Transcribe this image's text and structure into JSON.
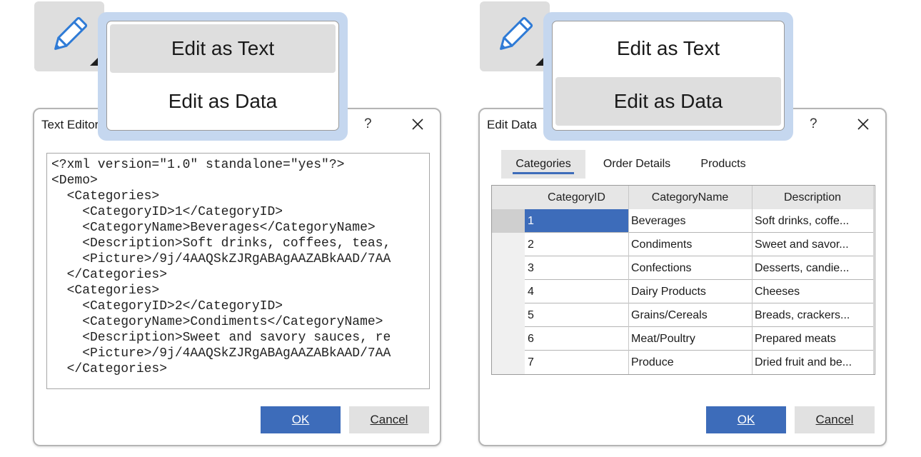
{
  "left": {
    "menu": {
      "items": [
        "Edit as Text",
        "Edit as Data"
      ],
      "highlighted": "Edit as Text"
    },
    "dialog": {
      "title": "Text Editor",
      "help_label": "?",
      "code_lines": [
        "<?xml version=\"1.0\" standalone=\"yes\"?>",
        "<Demo>",
        "  <Categories>",
        "    <CategoryID>1</CategoryID>",
        "    <CategoryName>Beverages</CategoryName>",
        "    <Description>Soft drinks, coffees, teas,",
        "    <Picture>/9j/4AAQSkZJRgABAgAAZABkAAD/7AA",
        "  </Categories>",
        "  <Categories>",
        "    <CategoryID>2</CategoryID>",
        "    <CategoryName>Condiments</CategoryName>",
        "    <Description>Sweet and savory sauces, re",
        "    <Picture>/9j/4AAQSkZJRgABAgAAZABkAAD/7AA",
        "  </Categories>"
      ],
      "ok_label": "OK",
      "cancel_label": "Cancel"
    }
  },
  "right": {
    "menu": {
      "items": [
        "Edit as Text",
        "Edit as Data"
      ],
      "highlighted": "Edit as Data"
    },
    "dialog": {
      "title": "Edit Data",
      "help_label": "?",
      "tabs": [
        "Categories",
        "Order Details",
        "Products"
      ],
      "active_tab": "Categories",
      "columns": [
        "CategoryID",
        "CategoryName",
        "Description"
      ],
      "rows": [
        [
          "1",
          "Beverages",
          "Soft drinks, coffe..."
        ],
        [
          "2",
          "Condiments",
          "Sweet and savor..."
        ],
        [
          "3",
          "Confections",
          "Desserts, candie..."
        ],
        [
          "4",
          "Dairy Products",
          "Cheeses"
        ],
        [
          "5",
          "Grains/Cereals",
          "Breads, crackers..."
        ],
        [
          "6",
          "Meat/Poultry",
          "Prepared meats"
        ],
        [
          "7",
          "Produce",
          "Dried fruit and be..."
        ]
      ],
      "selected_cell": {
        "row": 1,
        "column": "CategoryID"
      },
      "ok_label": "OK",
      "cancel_label": "Cancel"
    }
  },
  "icons": {
    "edit_button": "pencil-icon",
    "dropdown": "caret-icon",
    "close": "close-icon"
  },
  "colors": {
    "accent": "#3d6cba",
    "menu_halo": "#c5d7ef",
    "hover": "#dedede"
  }
}
